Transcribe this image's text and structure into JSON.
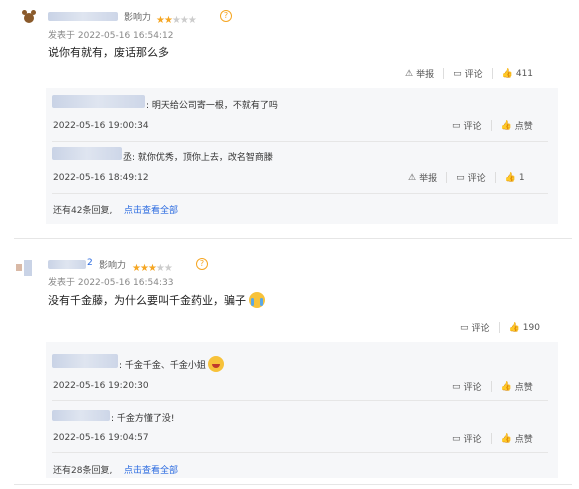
{
  "comments": [
    {
      "influence_label": "影响力",
      "rating": 2.5,
      "timestamp": "发表于 2022-05-16 16:54:12",
      "text": "说你有就有，废话那么多",
      "actions": {
        "report": "举报",
        "comment": "评论",
        "likes": "411"
      },
      "replies": [
        {
          "text": ": 明天给公司寄一根，不就有了吗",
          "time": "2022-05-16 19:00:34",
          "comment": "评论",
          "like": "点赞"
        },
        {
          "text": "丞: 就你优秀，顶你上去，改名智商滕",
          "time": "2022-05-16 18:49:12",
          "report": "举报",
          "comment": "评论",
          "like": "1"
        }
      ],
      "more_prefix": "还有42条回复,",
      "more_link": "点击查看全部"
    },
    {
      "name_suffix": "2",
      "influence_label": "影响力",
      "rating": 2.5,
      "timestamp": "发表于 2022-05-16 16:54:33",
      "text": "没有千金藤，为什么要叫千金药业，骗子",
      "actions": {
        "comment": "评论",
        "likes": "190"
      },
      "replies": [
        {
          "text": ": 千金千金、千金小姐",
          "time": "2022-05-16 19:20:30",
          "comment": "评论",
          "like": "点赞"
        },
        {
          "text": ": 千金方懂了没!",
          "time": "2022-05-16 19:04:57",
          "comment": "评论",
          "like": "点赞"
        }
      ],
      "more_prefix": "还有28条回复,",
      "more_link": "点击查看全部"
    }
  ],
  "icons": {
    "help": "?",
    "report": "warning-triangle-icon",
    "comment": "comment-icon",
    "like": "thumbs-up-icon"
  },
  "colors": {
    "star": "#f5a623",
    "link": "#2a6ae0",
    "reply_bg": "#f6f7f9"
  }
}
